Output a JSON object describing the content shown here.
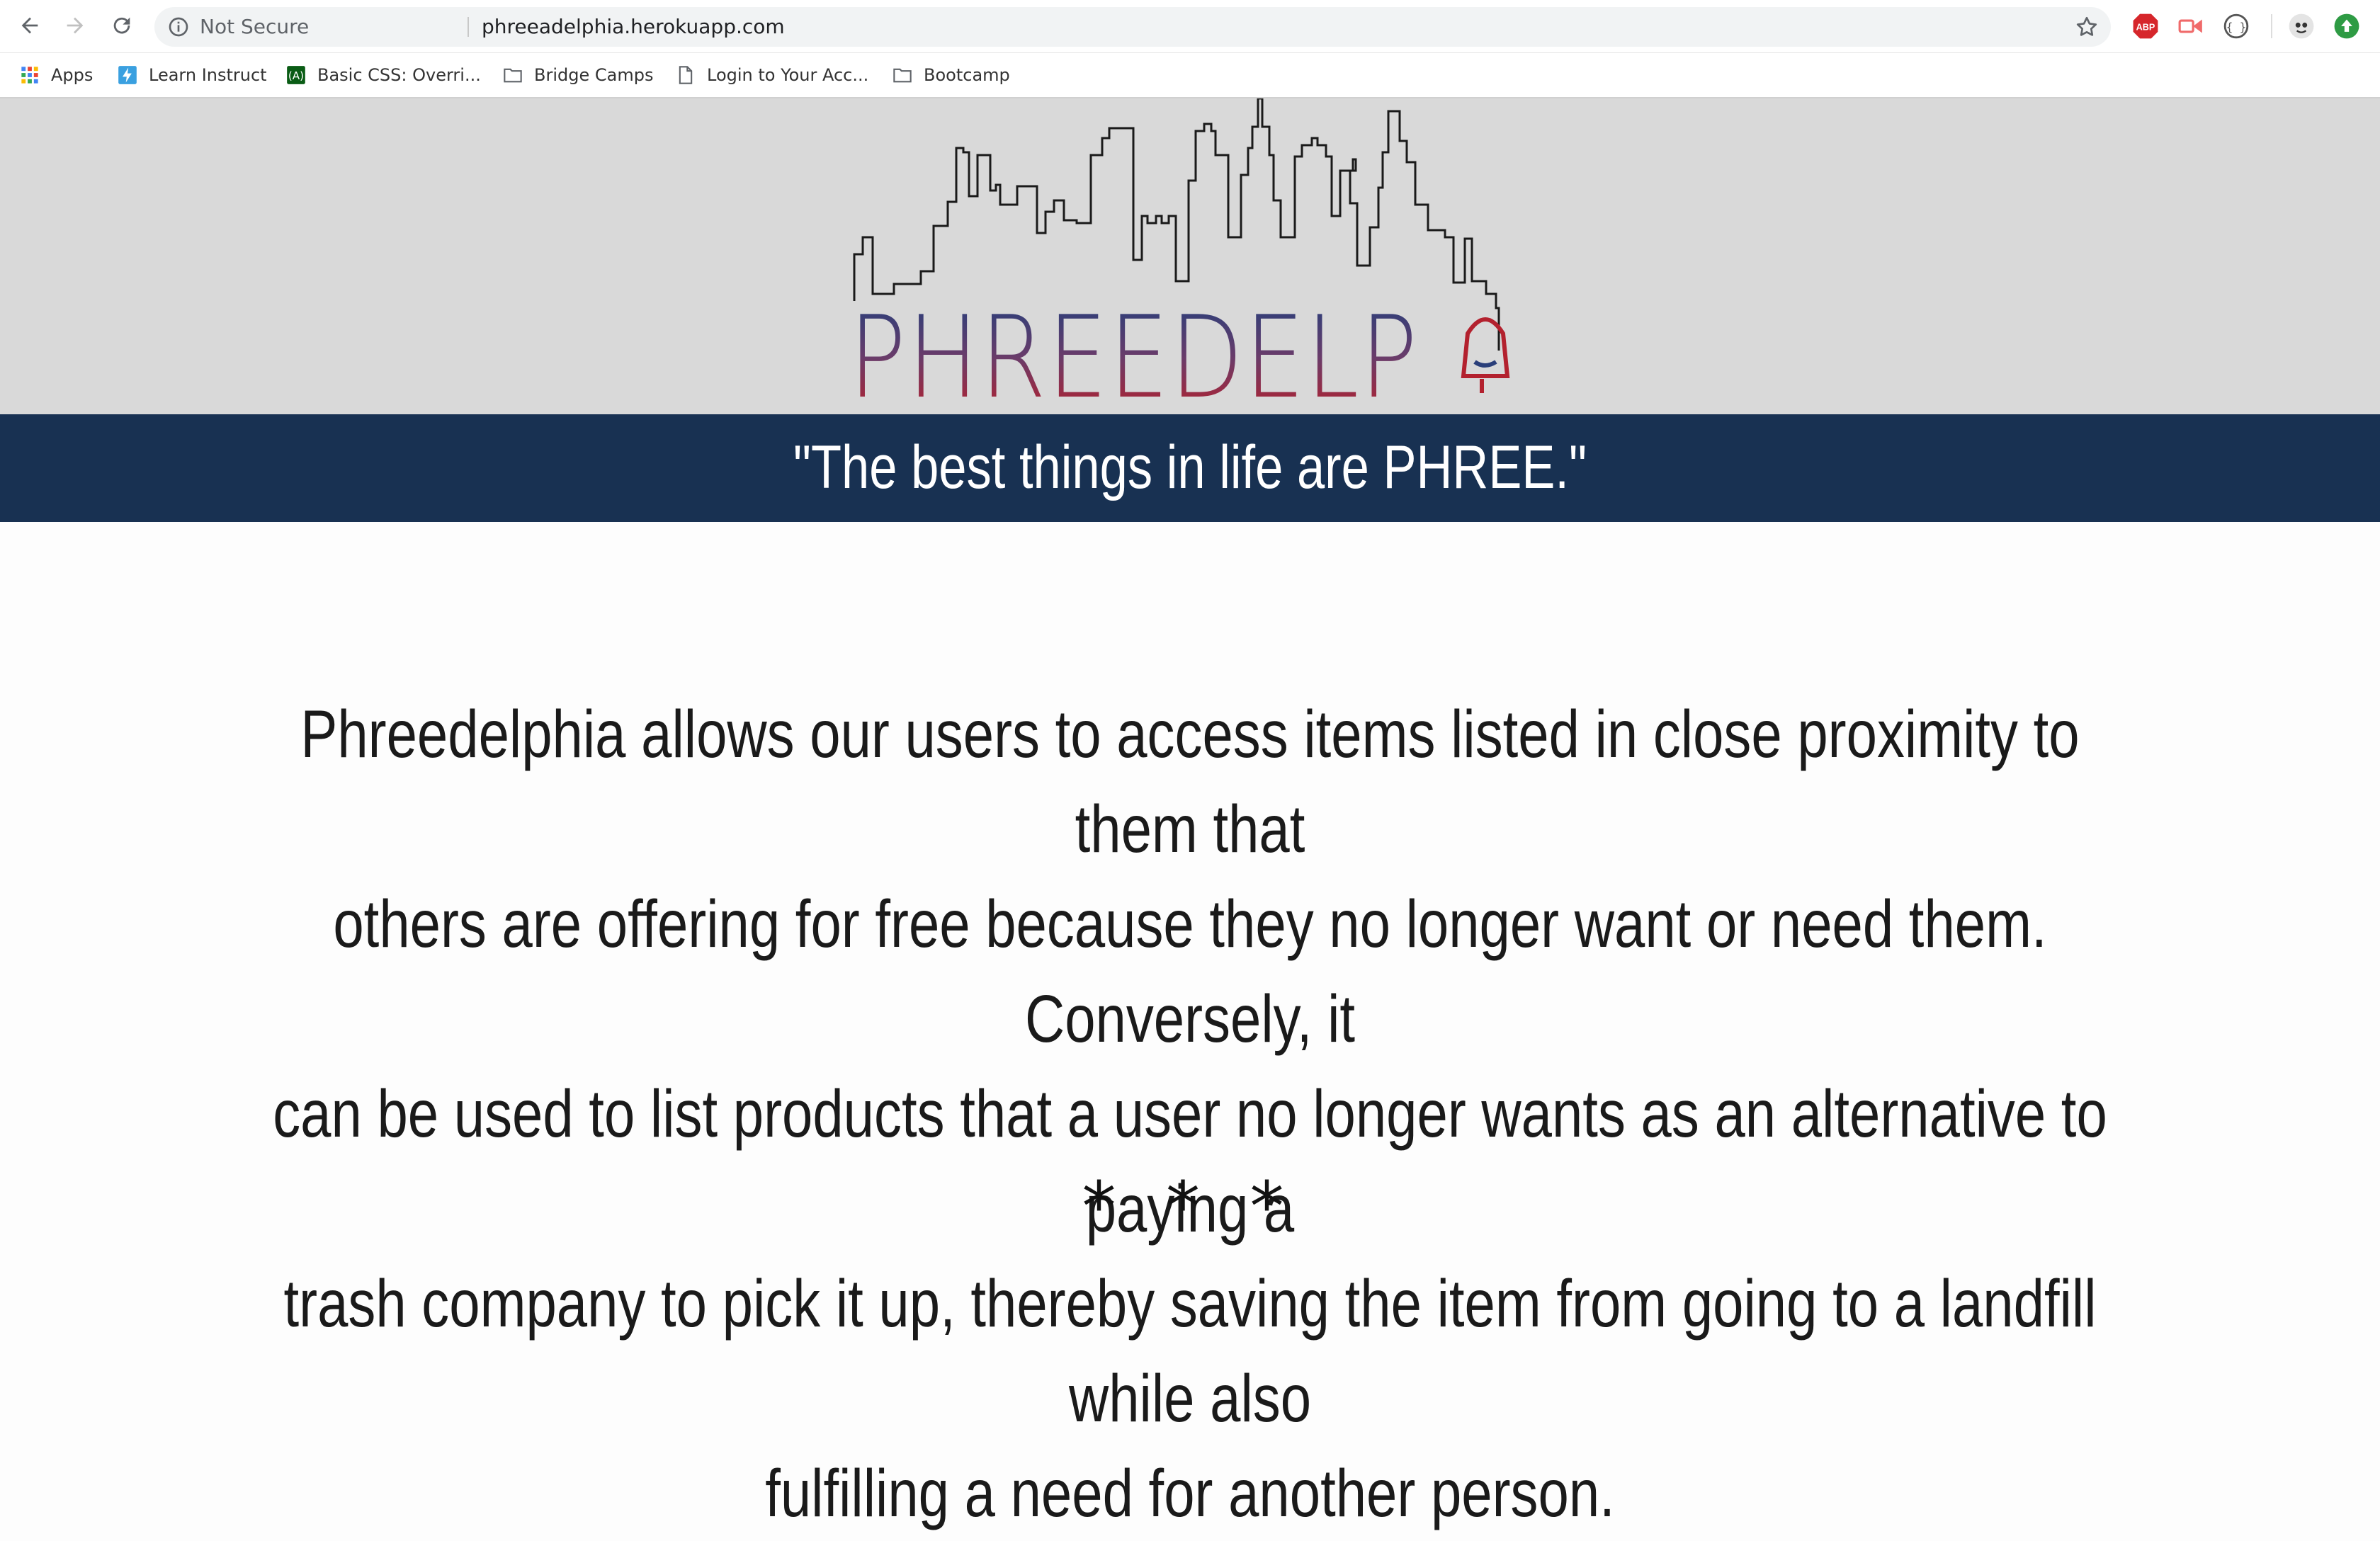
{
  "browser": {
    "security_label": "Not Secure",
    "url": "phreeadelphia.herokuapp.com",
    "bookmarks": [
      {
        "label": "Apps",
        "icon": "apps-grid-icon"
      },
      {
        "label": "Learn Instruct",
        "icon": "learn-bolt-icon"
      },
      {
        "label": "Basic CSS: Overri...",
        "icon": "freecodecamp-icon"
      },
      {
        "label": "Bridge Camps",
        "icon": "folder-icon"
      },
      {
        "label": "Login to Your Acc...",
        "icon": "page-icon"
      },
      {
        "label": "Bootcamp",
        "icon": "folder-icon"
      }
    ],
    "extensions": [
      "adblock-plus-icon",
      "screencast-icon",
      "code-brackets-icon",
      "profile-icon",
      "update-icon"
    ]
  },
  "hero": {
    "logo_text": "PHREEDELPHIA",
    "tagline": "\"The best things in life are PHREE.\""
  },
  "about": {
    "line1": "Phreedelphia allows our users to access items listed in close proximity to them that",
    "line2": "others are offering for free because they no longer want or need them. Conversely, it",
    "line3": "can be used to list products that a user no longer wants as an alternative to paying a",
    "line4": "trash company to pick it up, thereby saving the item from going to a landfill while also",
    "line5": "fulfilling a need for another person.",
    "divider": "* * *"
  },
  "colors": {
    "tagline_bar": "#183152",
    "hero_bg": "#d9d9d9",
    "logo_blue": "#2a3f7a",
    "logo_red": "#b3212e"
  }
}
